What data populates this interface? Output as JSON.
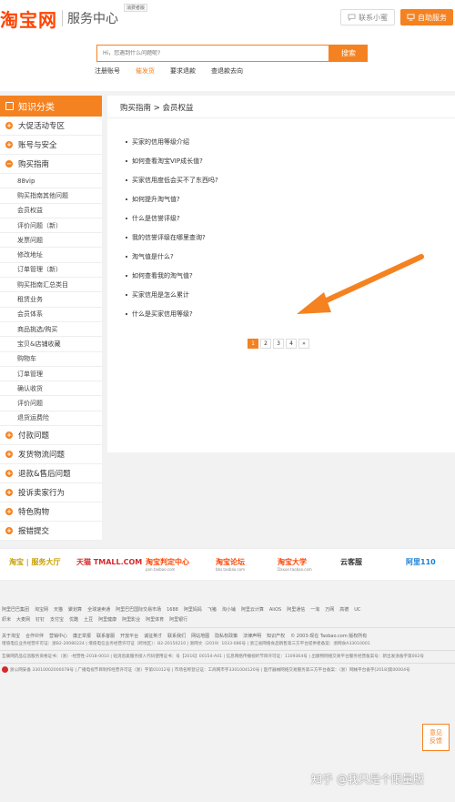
{
  "header": {
    "logo_main": "淘宝网",
    "logo_sub": "服务中心",
    "logo_badge": "消费者版",
    "contact_label": "联系小蜜",
    "service_label": "自助服务",
    "search_placeholder": "Hi，您遇到什么问题呢?",
    "search_button": "搜索",
    "quick_links": [
      "注册账号",
      "催发货",
      "要求退款",
      "查退款去向"
    ]
  },
  "sidebar": {
    "title": "知识分类",
    "top_categories": [
      "大促活动专区",
      "账号与安全"
    ],
    "open_category": "购买指南",
    "sub_items": [
      "88vip",
      "购买指南其他问题",
      "会员权益",
      "评价问题（新）",
      "发票问题",
      "修改地址",
      "订单管理（新）",
      "购买指南汇总类目",
      "租赁业务",
      "会员体系",
      "商品挑选/购买",
      "宝贝&店铺收藏",
      "购物车",
      "订单管理",
      "确认收货",
      "评价问题",
      "退货运费险"
    ],
    "bottom_categories": [
      "付款问题",
      "发货物流问题",
      "退款&售后问题",
      "投诉卖家行为",
      "特色购物",
      "报错提交"
    ]
  },
  "content": {
    "breadcrumb": "购买指南 > 会员权益",
    "questions": [
      "买家的信用等级介绍",
      "如何查看淘宝VIP成长值?",
      "买家信用度低会买不了东西吗?",
      "如何提升淘气值?",
      "什么是信誉评级?",
      "我的信誉评级在哪里查询?",
      "淘气值是什么?",
      "如何查看我的淘气值?",
      "买家信用是怎么累计",
      "什么是买家信用等级?"
    ],
    "pager": [
      "1",
      "2",
      "3",
      "4",
      "»"
    ],
    "arrow_color": "#f58220"
  },
  "partners": [
    {
      "name": "淘宝 | 服务大厅",
      "sub": "",
      "color": "#c8a000"
    },
    {
      "name": "天猫 TMALL.COM",
      "sub": "",
      "color": "#d7282a"
    },
    {
      "name": "淘宝判定中心",
      "sub": "pan.taobao.com",
      "color": "#ff4400"
    },
    {
      "name": "淘宝论坛",
      "sub": "bbs.taobao.com",
      "color": "#ff4400"
    },
    {
      "name": "淘宝大学",
      "sub": "Daxue.taobao.com",
      "color": "#ff4400"
    },
    {
      "name": "云客服",
      "sub": "",
      "color": "#333333"
    },
    {
      "name": "阿里110",
      "sub": "",
      "color": "#1a7fd4"
    }
  ],
  "footer": {
    "row1": [
      "阿里巴巴集团",
      "淘宝网",
      "天猫",
      "聚划算",
      "全球速卖通",
      "阿里巴巴国际交易市场",
      "1688",
      "阿里妈妈",
      "飞猪",
      "淘小铺",
      "阿里云计算",
      "AliOS",
      "阿里通信",
      "一淘",
      "万网",
      "高德",
      "UC"
    ],
    "row2": [
      "虾米",
      "大麦网",
      "钉钉",
      "支付宝",
      "优酷",
      "土豆",
      "阿里健康",
      "阿里影业",
      "阿里体育",
      "阿里银行"
    ],
    "row3": [
      "关于淘宝",
      "合作伙伴",
      "营销中心",
      "廉正举报",
      "联系客服",
      "开放平台",
      "诚征英才",
      "联系我们",
      "网站地图",
      "隐私权政策",
      "法律声明",
      "知识产权",
      "© 2003-现在 Taobao.com 版权所有"
    ],
    "row4": "增值电信业务经营许可证：浙B2-20080224  |  增值电信业务经营许可证（跨地区）：B2-20150210  |  浙网文（2019）1033-086号  |  浙江省网络食品销售第三方平台提供者备案：浙网食A33010001",
    "row5": "互联网药品信息服务资格证书：（浙）-经营性-2018-0010  |  短消息类服务接入代码使用证书：号【2016】00154-A01  |  信息网络传播视听节目许可证：1109364号  |  出版物网络交易平台服务经营备案号：新出发浙备字第002号",
    "row6": "浙公网安备 33010002000078号  |  广播电视节目制作经营许可证（浙）字第01012号  |  市场名称登记证：工商网市字3301004120号  |  医疗器械网络交易服务第三方平台备案：（浙）网械平台备字[2018]第00004号"
  },
  "feedback_label_1": "意见",
  "feedback_label_2": "反馈",
  "watermark": "知乎 @我只是个限量版"
}
